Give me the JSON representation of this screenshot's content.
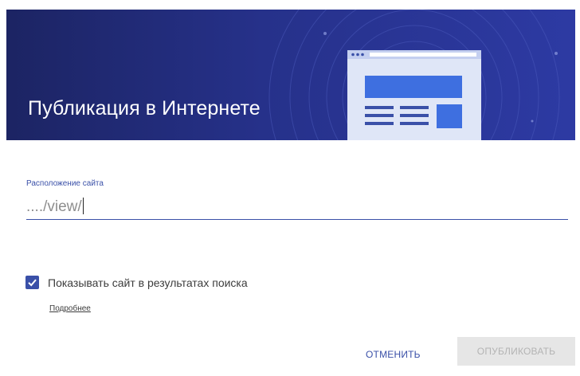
{
  "dialog": {
    "title": "Публикация в Интернете",
    "header_color": "#26318a",
    "accent_color": "#3a50a8",
    "illustration": "browser-window-illustration"
  },
  "site_location": {
    "label": "Расположение сайта",
    "value": "..../view/"
  },
  "search_visibility": {
    "checked": true,
    "label": "Показывать сайт в результатах поиска",
    "icon": "checkmark-icon"
  },
  "more_link": "Подробнее",
  "actions": {
    "cancel_label": "ОТМЕНИТЬ",
    "publish_label": "ОПУБЛИКОВАТЬ",
    "publish_disabled": true
  }
}
